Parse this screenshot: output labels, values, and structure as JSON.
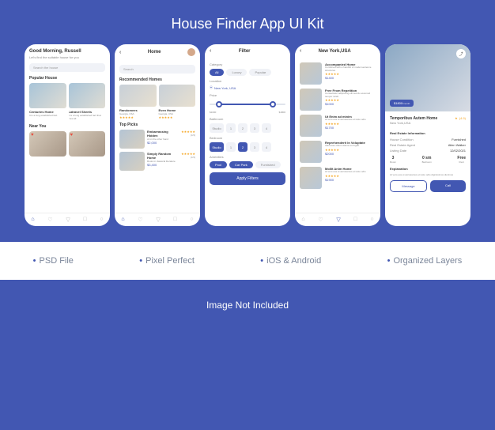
{
  "header": "House Finder App UI Kit",
  "screens": {
    "home1": {
      "greeting": "Good Morning, Russell",
      "sub": "Let's find the suitable house for you",
      "search": "Search the house",
      "sections": {
        "popular": "Popular House",
        "near": "Near You"
      },
      "cards": [
        {
          "title": "Centuries Home",
          "sub": "It is a long established fact"
        },
        {
          "title": "Latravel Sheets",
          "sub": "It is a long established fact that view all"
        }
      ]
    },
    "home2": {
      "title": "Home",
      "search": "Search",
      "sections": {
        "rec": "Recommended Homes",
        "top": "Top Picks"
      },
      "rec": [
        {
          "title": "Randomees",
          "loc": "Georgia, USA"
        },
        {
          "title": "Even Home",
          "loc": "Georgia, USA"
        }
      ],
      "picks": [
        {
          "title": "Embarrassing Hidden",
          "sub": "of on the other hand",
          "price": "$2,000"
        },
        {
          "title": "Simply Random Home",
          "sub": "Roots in classical literature",
          "price": "$3,400"
        }
      ]
    },
    "filter": {
      "title": "Filter",
      "labels": {
        "category": "Category",
        "location": "Location",
        "price": "Price",
        "bathroom": "Bathroom",
        "bedroom": "Bedroom",
        "amenities": "Amenities"
      },
      "chips": [
        "All",
        "Luxury",
        "Popular"
      ],
      "location": "New York, USA",
      "price_min": "$1000",
      "price_max": "$1800",
      "nums": [
        "Studio",
        "1",
        "2",
        "3",
        "4"
      ],
      "amenities": [
        "Pool",
        "Car Park",
        "Furnished"
      ],
      "apply": "Apply Filters"
    },
    "list": {
      "title": "New York,USA",
      "items": [
        {
          "title": "Accompanied Home",
          "sub": "Combined with a handful of model sentence structures",
          "price": "$1400"
        },
        {
          "title": "Free From Repetition",
          "sub": "Consectetur adipiscing elit sed do eiusmod tempor incidi",
          "price": "$1000"
        },
        {
          "title": "Ut Enim ad minim",
          "sub": "At vero eos et accusamus et iusto odio",
          "price": "$1700"
        },
        {
          "title": "Reprehenderit In Voluptate",
          "sub": "Velit esse cillum dolore eu fugiat",
          "price": "$2000"
        },
        {
          "title": "Mollit Anim Home",
          "sub": "At vero eos et accusamus et iusto odio",
          "price": "$1900"
        }
      ]
    },
    "detail": {
      "tag_price": "$1800",
      "tag_sub": "/month",
      "title": "Temporibus Autem Home",
      "loc": "New York,USA",
      "rating": "(4.9)",
      "section1": "Real Estate Information",
      "kvs": [
        {
          "k": "House Condition",
          "v": "Furnished"
        },
        {
          "k": "Real Estate Agent",
          "v": "Allen Walker"
        },
        {
          "k": "Listing Date",
          "v": "12/02/2021"
        }
      ],
      "specs": [
        {
          "v": "3",
          "l": "Room"
        },
        {
          "v": "0 sm",
          "l": "Bedroom"
        },
        {
          "v": "Free",
          "l": "Rent"
        }
      ],
      "section2": "Explanation",
      "desc": "At vero eos et accusamus et iusto odio dignissimos ducimus",
      "btn_msg": "Message",
      "btn_call": "Call"
    }
  },
  "features": [
    "PSD File",
    "Pixel Perfect",
    "iOS & Android",
    "Organized Layers"
  ],
  "footer": "Image Not Included"
}
